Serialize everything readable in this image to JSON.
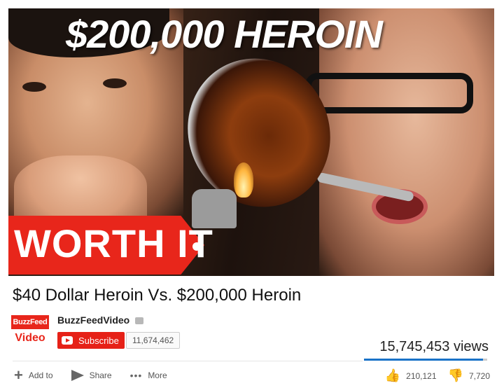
{
  "thumbnail": {
    "overlay_title": "$200,000 HEROIN",
    "badge_text": "WORTH IT"
  },
  "video": {
    "title": "$40 Dollar Heroin Vs. $200,000 Heroin",
    "views": "15,745,453 views",
    "likes": "210,121",
    "dislikes": "7,720",
    "like_fraction": 0.965
  },
  "channel": {
    "logo_top": "BuzzFeed",
    "logo_bottom": "Video",
    "name": "BuzzFeedVideo",
    "subscribe_label": "Subscribe",
    "subscriber_count": "11,674,462"
  },
  "actions": {
    "add_to": "Add to",
    "share": "Share",
    "more": "More"
  },
  "colors": {
    "brand_red": "#e8261b",
    "like_bar": "#1a73c8"
  },
  "icons": [
    "plus-icon",
    "share-icon",
    "more-icon",
    "thumb-up-icon",
    "thumb-down-icon",
    "verified-icon",
    "youtube-play-icon"
  ]
}
